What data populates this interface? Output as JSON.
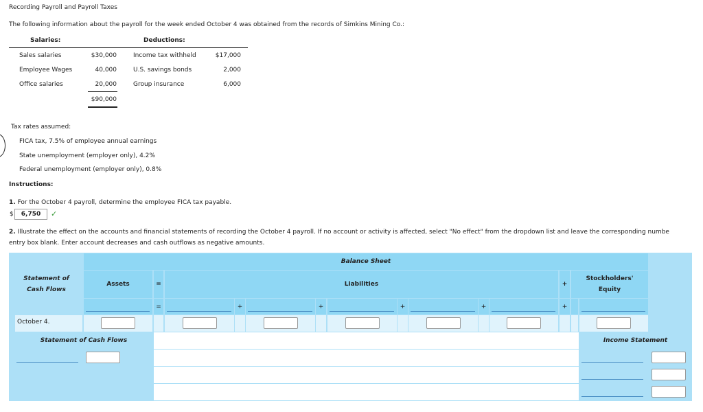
{
  "title": "Recording Payroll and Payroll Taxes",
  "intro": "The following information about the payroll for the week ended October 4 was obtained from the records of Simkins Mining Co.:",
  "salaries": {
    "header": "Salaries:",
    "items": [
      {
        "label": "Sales salaries",
        "amount": "$30,000"
      },
      {
        "label": "Employee Wages",
        "amount": "40,000"
      },
      {
        "label": "Office salaries",
        "amount": "20,000"
      }
    ],
    "total": "$90,000"
  },
  "deductions": {
    "header": "Deductions:",
    "items": [
      {
        "label": "Income tax withheld",
        "amount": "$17,000"
      },
      {
        "label": "U.S. savings bonds",
        "amount": "2,000"
      },
      {
        "label": "Group insurance",
        "amount": "6,000"
      }
    ]
  },
  "tax_rates": {
    "header": "Tax rates assumed:",
    "items": [
      "FICA tax, 7.5% of employee annual earnings",
      "State unemployment (employer only), 4.2%",
      "Federal unemployment (employer only), 0.8%"
    ]
  },
  "instructions_header": "Instructions:",
  "q1": {
    "num": "1.",
    "text": "For the October 4 payroll, determine the employee FICA tax payable.",
    "currency": "$",
    "answer": "6,750",
    "status": "correct",
    "check_color": "#3a9a3a"
  },
  "q2": {
    "num": "2.",
    "text_line1": "Illustrate the effect on the accounts and financial statements of recording the October 4 payroll. If no account or activity is affected, select \"No effect\" from the dropdown list and leave the corresponding numbe",
    "text_line2": "entry box blank. Enter account decreases and cash outflows as negative amounts."
  },
  "table": {
    "balance_sheet": "Balance Sheet",
    "scf_header_1": "Statement of",
    "scf_header_2": "Cash Flows",
    "assets": "Assets",
    "equals": "=",
    "liabilities": "Liabilities",
    "plus": "+",
    "se_1": "Stockholders'",
    "se_2": "Equity",
    "row_label": "October 4.",
    "scf_section": "Statement of Cash Flows",
    "is_section": "Income Statement"
  },
  "colors": {
    "panel": "#ade0f7",
    "header": "#8fd7f4",
    "row": "#e0f3fc"
  }
}
